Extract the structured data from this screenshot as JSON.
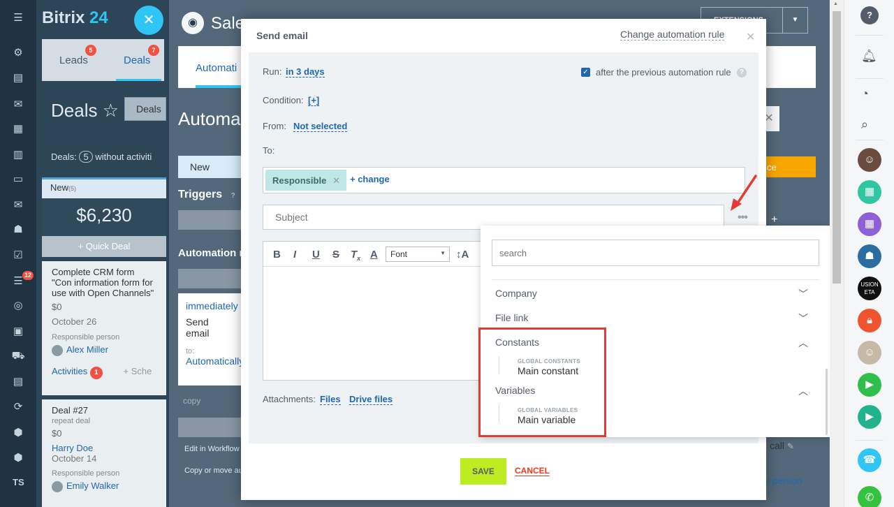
{
  "brand": {
    "name_main": "Bitrix",
    "name_num": "24"
  },
  "crm": {
    "tabs": [
      {
        "label": "Leads",
        "badge": "5"
      },
      {
        "label": "Deals",
        "badge": "7"
      }
    ],
    "title": "Deals",
    "deals_button": "Deals",
    "deals_info_prefix": "Deals:",
    "deals_info_count": "5",
    "deals_info_suffix": "without activiti",
    "new_column": {
      "label": "New",
      "count": "(5)"
    },
    "sum": "$6,230",
    "quick_deal": "+ Quick Deal",
    "cards": [
      {
        "title": "Complete CRM form \"Con information form for use with Open Channels\"",
        "amount": "$0",
        "date": "October 26",
        "resp_label": "Responsible person",
        "person": "Alex Miller",
        "activities": "Activities",
        "activities_badge": "1",
        "schedule": "+ Sche"
      },
      {
        "title": "Deal #27",
        "subtitle": "repeat deal",
        "amount": "$0",
        "contact": "Harry Doe",
        "date": "October 14",
        "resp_label": "Responsible person",
        "person": "Emily Walker"
      }
    ],
    "left_bar_badge": "12",
    "left_bar_user": "TS"
  },
  "automation": {
    "header": "Sale",
    "extensions": "EXTENSIONS",
    "tab": "Automati",
    "title": "Automa",
    "stage_new": "New",
    "triggers": "Triggers",
    "triggers_help": "?",
    "rules_title": "Automation r",
    "card": {
      "run": "immediately",
      "action": "Send email",
      "to_label": "to:",
      "to_value": "Automatically"
    },
    "copy_label": "copy",
    "edit_workflow": "Edit in Workflow",
    "copy_move": "Copy or move au",
    "orange_label": "ce",
    "call_text": "call",
    "person_text": "e person"
  },
  "modal": {
    "title": "Send email",
    "change_rule": "Change automation rule",
    "run_label": "Run:",
    "run_value": "in 3 days",
    "after_prev": "after the previous automation rule",
    "condition_label": "Condition:",
    "condition_value": "[+]",
    "from_label": "From:",
    "from_value": "Not selected",
    "to_label": "To:",
    "to_tag": "Responsible",
    "to_change": "+ change",
    "subject_placeholder": "Subject",
    "font_select": "Font",
    "attachments_label": "Attachments:",
    "files_link": "Files",
    "drive_link": "Drive files",
    "save": "SAVE",
    "cancel": "CANCEL"
  },
  "popup": {
    "search_placeholder": "search",
    "groups": [
      {
        "label": "Company",
        "expanded": false
      },
      {
        "label": "File link",
        "expanded": false
      },
      {
        "label": "Constants",
        "expanded": true,
        "caption": "GLOBAL CONSTANTS",
        "item": "Main constant"
      },
      {
        "label": "Variables",
        "expanded": true,
        "caption": "GLOBAL VARIABLES",
        "item": "Main variable"
      }
    ]
  },
  "colors": {
    "accent_blue": "#2fc6f6",
    "link_blue": "#2067b0",
    "save_green": "#bbed21",
    "cancel_red": "#f0371b",
    "highlight_red": "#e53935",
    "badge_red": "#f25040"
  },
  "rightbar_logo_text": "USION ETA"
}
